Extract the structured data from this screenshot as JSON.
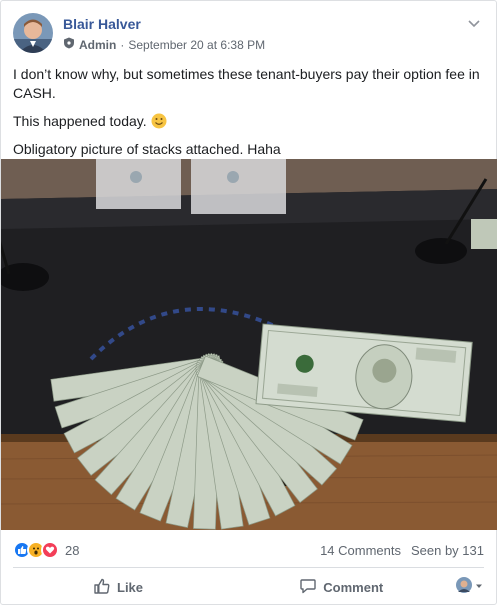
{
  "post": {
    "author": "Blair Halver",
    "role": "Admin",
    "separator": "·",
    "timestamp": "September 20 at 6:38 PM",
    "text_lines": [
      "I don’t know why, but sometimes these tenant-buyers pay their option fee in CASH.",
      "This happened today.",
      "Obligatory picture of stacks attached. Haha"
    ]
  },
  "reactions": {
    "types": [
      "like-icon",
      "wow-icon",
      "love-icon"
    ],
    "count": "28"
  },
  "stats": {
    "comments": "14 Comments",
    "seen": "Seen by 131"
  },
  "actions": {
    "like_label": "Like",
    "comment_label": "Comment"
  },
  "colors": {
    "author": "#385898",
    "like_blue": "#1877f2",
    "love_red": "#f33e58",
    "wow_yellow": "#f7b125",
    "muted": "#606770"
  }
}
